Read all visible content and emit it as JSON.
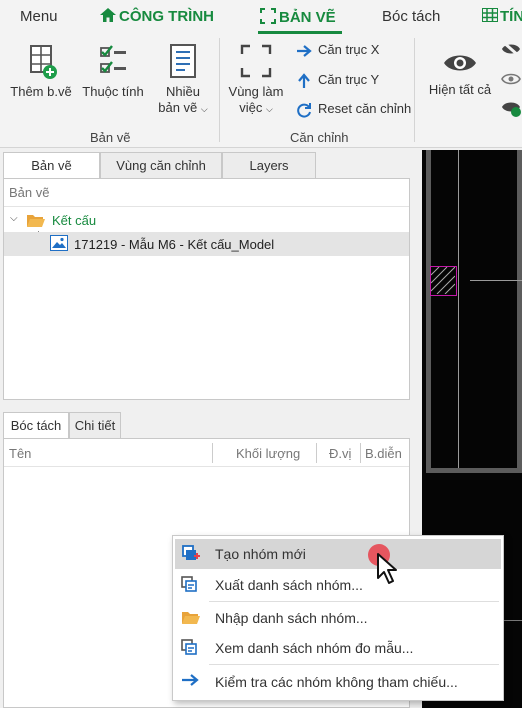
{
  "menubar": {
    "menu": "Menu",
    "cong_trinh": "CÔNG TRÌNH",
    "ban_ve": "BẢN VẼ",
    "boc_tach": "Bóc tách",
    "tinh": "TÍN"
  },
  "ribbon": {
    "them_ban_ve": "Thêm b.vẽ",
    "thuoc_tinh": "Thuộc tính",
    "nhieu_line1": "Nhiều",
    "nhieu_line2": "bản vẽ",
    "vung_lam_line1": "Vùng làm",
    "vung_lam_line2": "việc",
    "can_truc_x": "Căn trục X",
    "can_truc_y": "Căn trục Y",
    "reset_can_chinh": "Reset căn chỉnh",
    "hien_tat_ca": "Hiện tất cả",
    "group_ban_ve": "Bản vẽ",
    "group_can_chinh": "Căn chỉnh"
  },
  "top_tabs": [
    "Bản vẽ",
    "Vùng căn chỉnh",
    "Layers"
  ],
  "tree": {
    "header": "Bản vẽ",
    "folder": "Kết cấu",
    "drawing": "171219 - Mẫu M6 - Kết cấu_Model"
  },
  "bottom_tabs": [
    "Bóc tách",
    "Chi tiết"
  ],
  "table": {
    "col_ten": "Tên",
    "col_khoi_luong": "Khối lượng",
    "col_dvi": "Đ.vị",
    "col_bdien": "B.diễn"
  },
  "context_menu": {
    "items": [
      "Tạo nhóm mới",
      "Xuất danh sách nhóm...",
      "Nhập danh sách nhóm...",
      "Xem danh sách nhóm đo mẫu...",
      "Kiểm tra các nhóm không tham chiếu..."
    ]
  },
  "colors": {
    "accent_green": "#178a3f",
    "highlight_magenta": "#c21aa8",
    "cursor_red": "#e8404a"
  }
}
